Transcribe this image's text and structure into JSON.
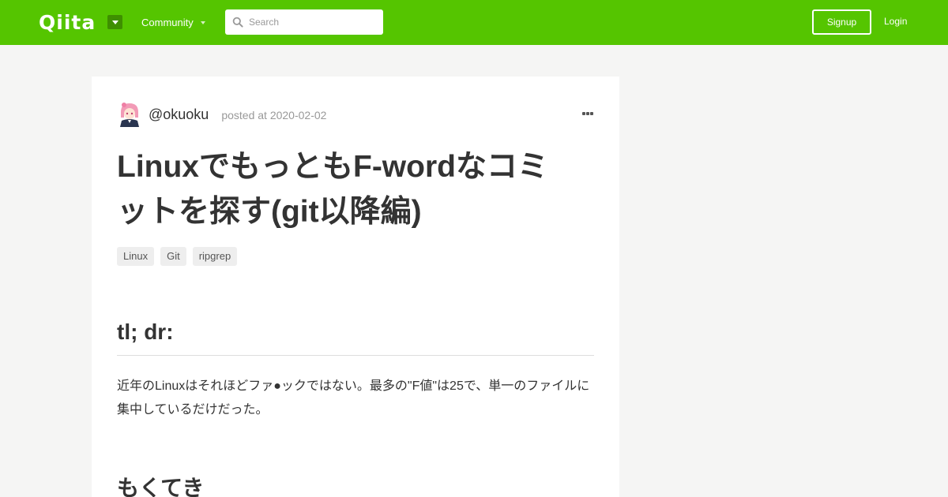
{
  "header": {
    "logo": "Qiita",
    "community_label": "Community",
    "search_placeholder": "Search",
    "signup_label": "Signup",
    "login_label": "Login",
    "brand_color": "#55c500"
  },
  "article": {
    "author": "@okuoku",
    "posted": "posted at 2020-02-02",
    "title": "LinuxでもっともF-wordなコミットを探す(git以降編)",
    "tags": [
      "Linux",
      "Git",
      "ripgrep"
    ],
    "section_heading": "tl; dr:",
    "paragraph": "近年のLinuxはそれほどファ●ックではない。最多の\"F値\"は25で、単一のファイルに集中しているだけだった。",
    "next_heading": "もくてき"
  }
}
